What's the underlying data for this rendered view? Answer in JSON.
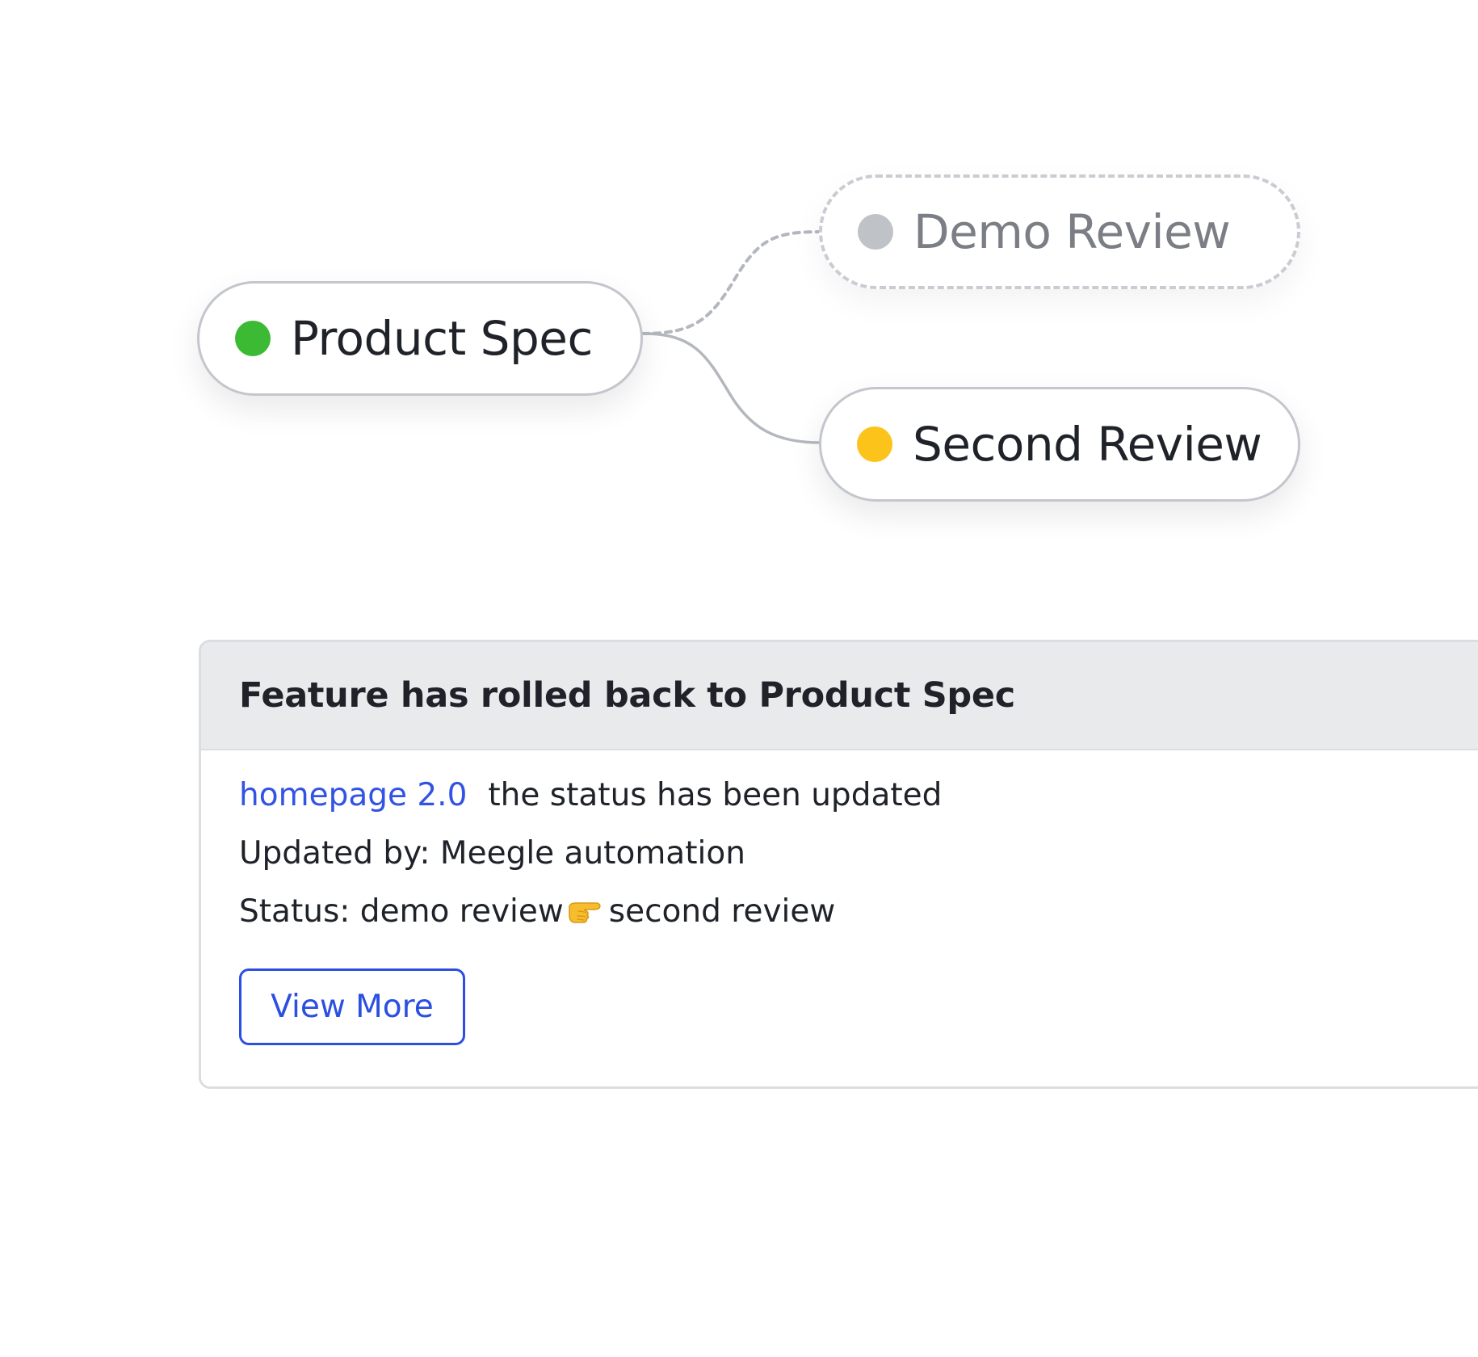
{
  "flow": {
    "nodes": [
      {
        "id": "product_spec",
        "label": "Product Spec",
        "status_color": "#3cba33",
        "text_color": "#1f2329",
        "state": "current"
      },
      {
        "id": "demo_review",
        "label": "Demo Review",
        "status_color": "#bfc2c7",
        "text_color": "#7b7e84",
        "state": "skipped"
      },
      {
        "id": "second_review",
        "label": "Second Review",
        "status_color": "#fcc31a",
        "text_color": "#1f2329",
        "state": "active"
      }
    ],
    "connector_color": "#b4b8be"
  },
  "notification": {
    "title": "Feature has rolled back to Product Spec",
    "link_text": "homepage 2.0",
    "status_message": "the status has been updated",
    "updated_by": "Updated by: Meegle automation",
    "status_prefix": "Status: demo review",
    "status_suffix": "second review",
    "status_icon": "pointing-right-hand-icon",
    "button_label": "View More",
    "accent_color": "#2b4fe0"
  }
}
